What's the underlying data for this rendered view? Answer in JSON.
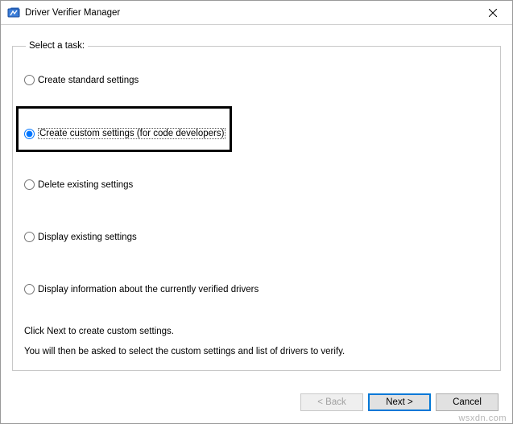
{
  "window": {
    "title": "Driver Verifier Manager"
  },
  "group": {
    "legend": "Select a task:"
  },
  "options": {
    "create_standard": "Create standard settings",
    "create_custom": "Create custom settings (for code developers)",
    "delete_existing": "Delete existing settings",
    "display_existing": "Display existing settings",
    "display_info": "Display information about the currently verified drivers"
  },
  "instructions": {
    "line1": "Click Next to create custom settings.",
    "line2": "You will then be asked to select the custom settings and list of drivers to verify."
  },
  "buttons": {
    "back": "< Back",
    "next": "Next >",
    "cancel": "Cancel"
  },
  "watermark": "wsxdn.com"
}
